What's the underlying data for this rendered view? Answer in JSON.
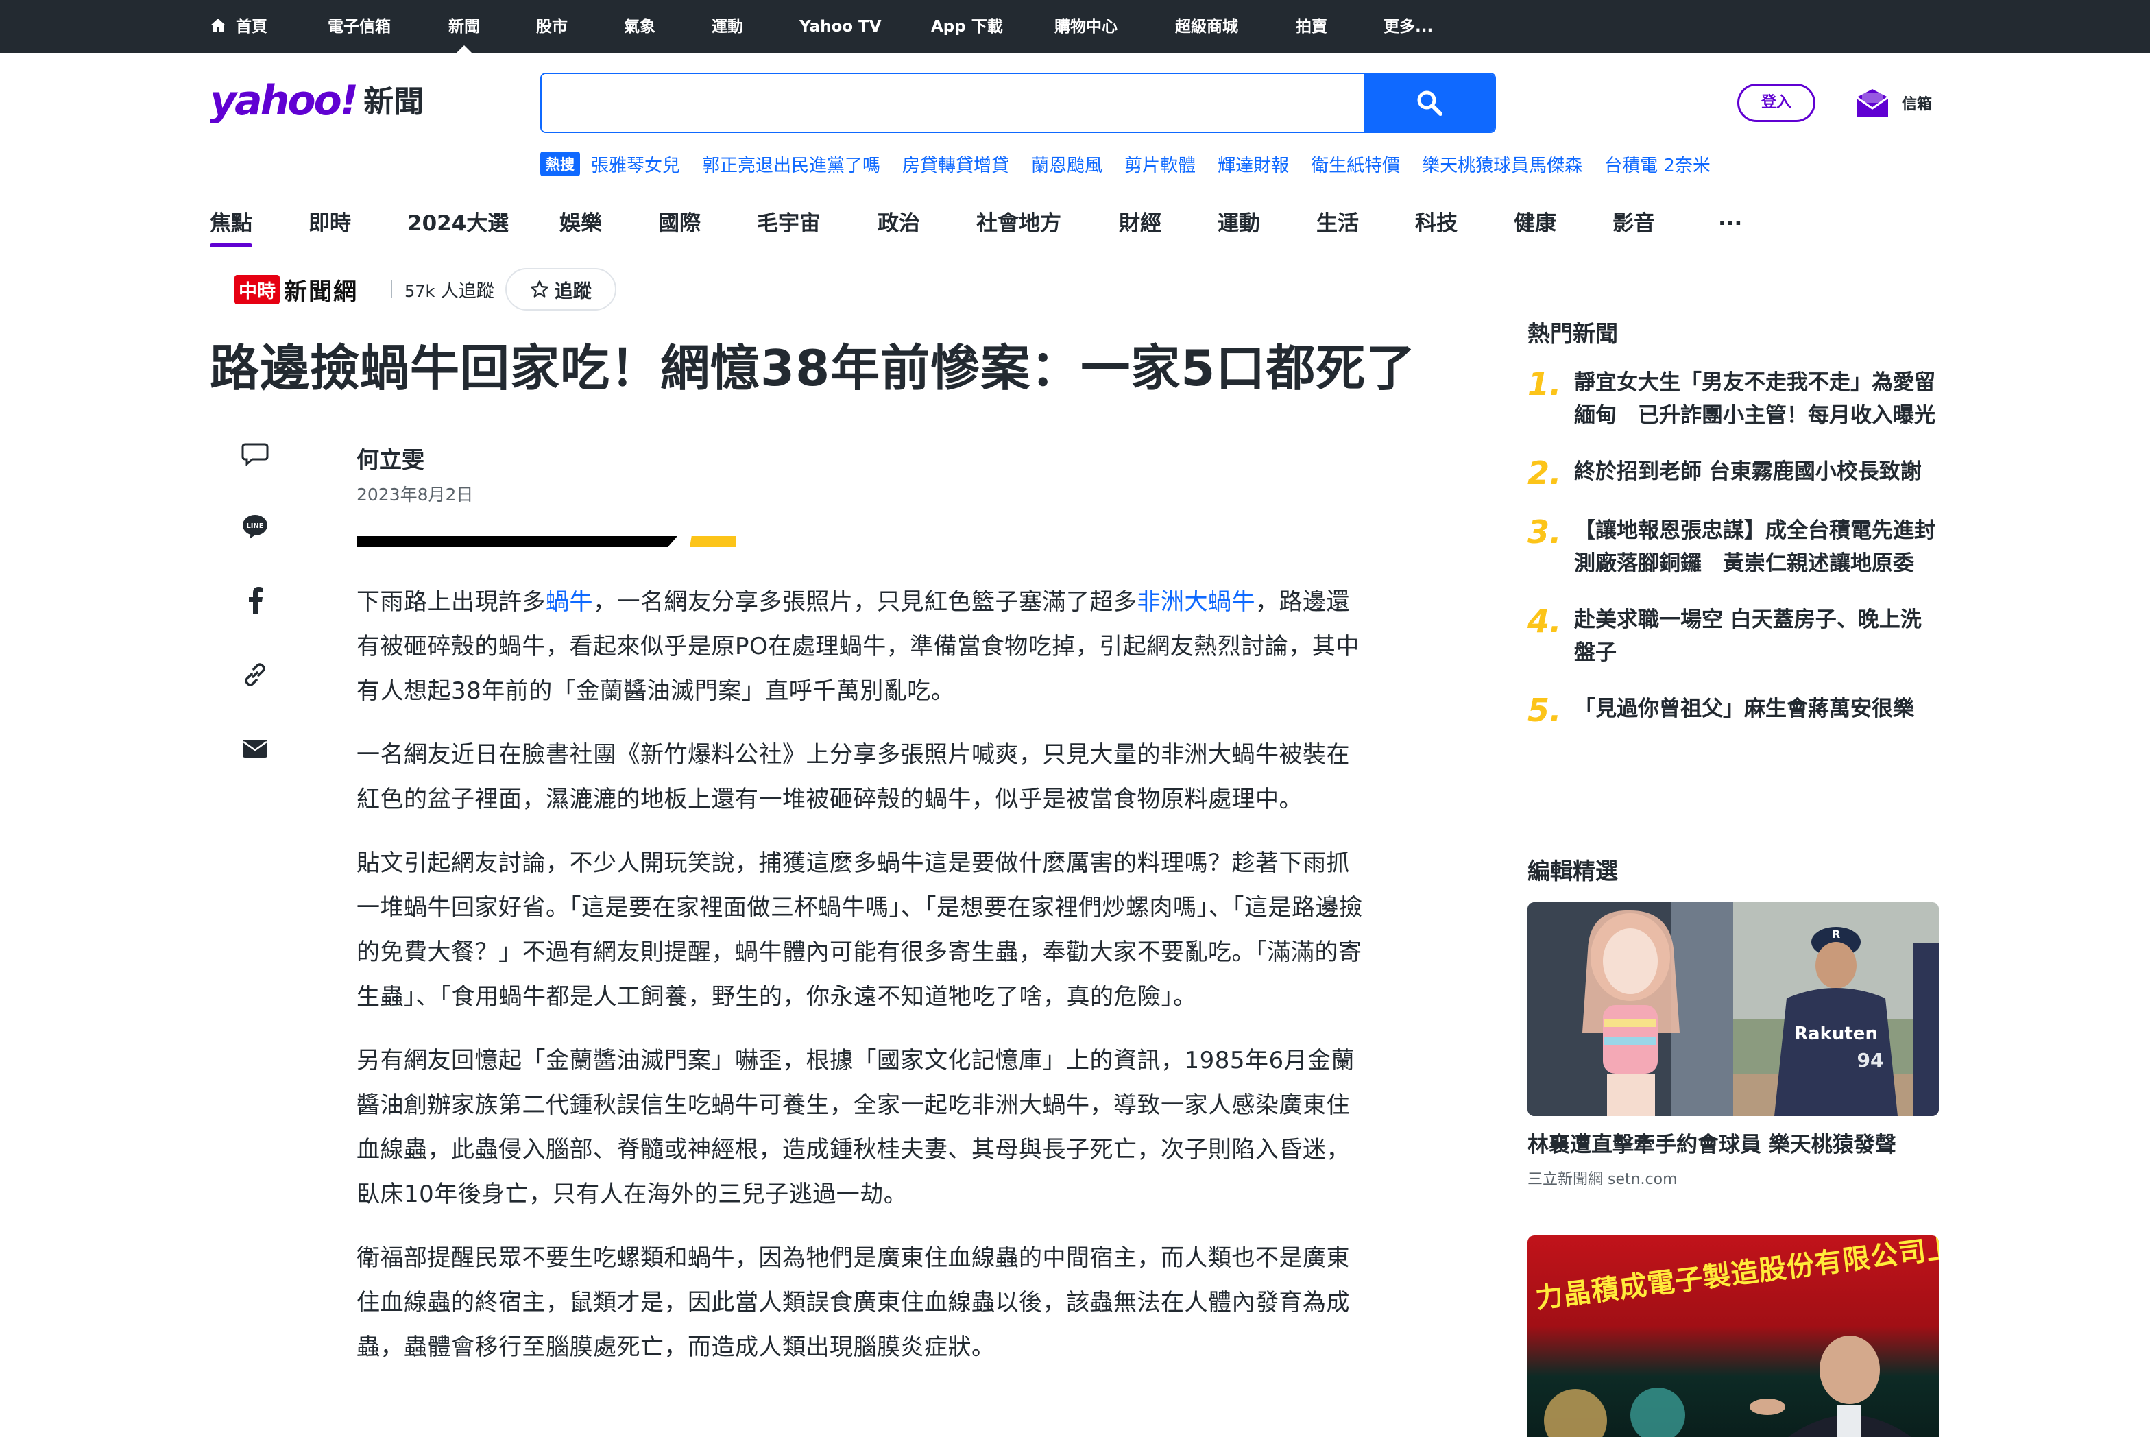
{
  "topnav": {
    "items": [
      "首頁",
      "電子信箱",
      "新聞",
      "股市",
      "氣象",
      "運動",
      "Yahoo TV",
      "App 下載",
      "購物中心",
      "超級商城",
      "拍賣",
      "更多..."
    ],
    "active": "新聞"
  },
  "header": {
    "logo_text": "yahoo!",
    "logo_sub": "新聞",
    "search": {
      "value": "",
      "placeholder": ""
    },
    "login_label": "登入",
    "mail_label": "信箱"
  },
  "trending": {
    "badge": "熱搜",
    "links": [
      "張雅琴女兒",
      "郭正亮退出民進黨了嗎",
      "房貸轉貸增貸",
      "蘭恩颱風",
      "剪片軟體",
      "輝達財報",
      "衛生紙特價",
      "樂天桃猿球員馬傑森",
      "台積電 2奈米"
    ]
  },
  "category_nav": {
    "items": [
      "焦點",
      "即時",
      "2024大選",
      "娛樂",
      "國際",
      "毛宇宙",
      "政治",
      "社會地方",
      "財經",
      "運動",
      "生活",
      "科技",
      "健康",
      "影音",
      "..."
    ],
    "active": "焦點"
  },
  "publisher": {
    "logo_box": "中時",
    "logo_text": "新聞網",
    "followers_num": "57k",
    "followers_label": "人追蹤",
    "follow_label": "追蹤"
  },
  "article": {
    "title": "路邊撿蝸牛回家吃！網憶38年前慘案：一家5口都死了",
    "author": "何立雯",
    "date": "2023年8月2日",
    "p1_pre": "下雨路上出現許多",
    "p1_link1": "蝸牛",
    "p1_mid": "，一名網友分享多張照片，只見紅色籃子塞滿了超多",
    "p1_link2": "非洲大蝸牛",
    "p1_post": "，路邊還有被砸碎殼的蝸牛，看起來似乎是原PO在處理蝸牛，準備當食物吃掉，引起網友熱烈討論，其中有人想起38年前的「金蘭醬油滅門案」直呼千萬別亂吃。",
    "p2": "一名網友近日在臉書社團《新竹爆料公社》上分享多張照片喊爽，只見大量的非洲大蝸牛被裝在紅色的盆子裡面，濕漉漉的地板上還有一堆被砸碎殼的蝸牛，似乎是被當食物原料處理中。",
    "p3": "貼文引起網友討論，不少人開玩笑說，捕獲這麼多蝸牛這是要做什麼厲害的料理嗎？趁著下雨抓一堆蝸牛回家好省。「這是要在家裡面做三杯蝸牛嗎」、「是想要在家裡們炒螺肉嗎」、「這是路邊撿的免費大餐？」不過有網友則提醒，蝸牛體內可能有很多寄生蟲，奉勸大家不要亂吃。「滿滿的寄生蟲」、「食用蝸牛都是人工飼養，野生的，你永遠不知道牠吃了啥，真的危險」。",
    "p4": "另有網友回憶起「金蘭醬油滅門案」嚇歪，根據「國家文化記憶庫」上的資訊，1985年6月金蘭醬油創辦家族第二代鍾秋誤信生吃蝸牛可養生，全家一起吃非洲大蝸牛，導致一家人感染廣東住血線蟲，此蟲侵入腦部、脊髓或神經根，造成鍾秋桂夫妻、其母與長子死亡，次子則陷入昏迷，臥床10年後身亡，只有人在海外的三兒子逃過一劫。",
    "p5": "衛福部提醒民眾不要生吃螺類和蝸牛，因為牠們是廣東住血線蟲的中間宿主，而人類也不是廣東住血線蟲的終宿主，鼠類才是，因此當人類誤食廣東住血線蟲以後，該蟲無法在人體內發育為成蟲，蟲體會移行至腦膜處死亡，而造成人類出現腦膜炎症狀。"
  },
  "share_icons": [
    "comment-icon",
    "line-icon",
    "facebook-icon",
    "link-icon",
    "mail-icon"
  ],
  "sidebar": {
    "hot_title": "熱門新聞",
    "hot_items": [
      {
        "num": "1.",
        "text": "靜宜女大生「男友不走我不走」為愛留緬甸　已升詐團小主管！每月收入曝光"
      },
      {
        "num": "2.",
        "text": "終於招到老師 台東霧鹿國小校長致謝"
      },
      {
        "num": "3.",
        "text": "【讓地報恩張忠謀】成全台積電先進封測廠落腳銅鑼　黃崇仁親述讓地原委"
      },
      {
        "num": "4.",
        "text": "赴美求職一場空 白天蓋房子、晚上洗盤子"
      },
      {
        "num": "5.",
        "text": "「見過你曾祖父」麻生會蔣萬安很樂"
      }
    ],
    "picks_title": "編輯精選",
    "pick_headline": "林襄遭直擊牽手約會球員 樂天桃猿發聲",
    "pick_source": "三立新聞網 setn.com",
    "jersey_text": "Rakuten",
    "jersey_num": "94",
    "ad_text": "力晶積成電子製造股份有限公司上市"
  },
  "colors": {
    "topbar_bg": "#232a31",
    "brand_purple": "#6001d2",
    "link_blue": "#0f69ff",
    "accent_yellow": "#fcc419",
    "publisher_red": "#e60012"
  }
}
